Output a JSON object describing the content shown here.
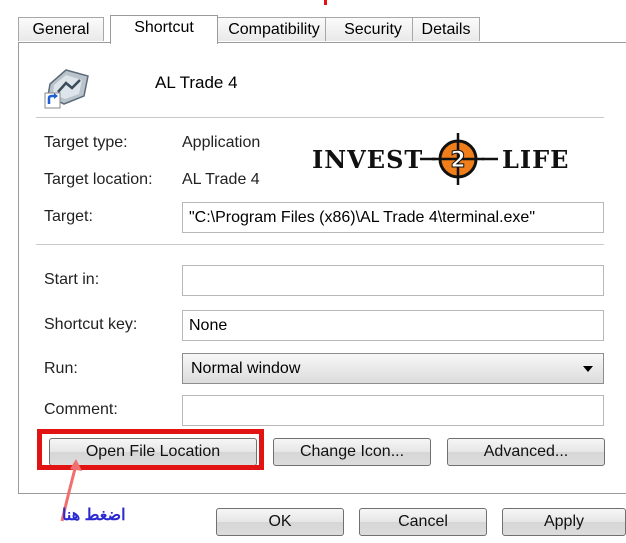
{
  "tabs": [
    {
      "label": "General"
    },
    {
      "label": "Shortcut"
    },
    {
      "label": "Compatibility"
    },
    {
      "label": "Security"
    },
    {
      "label": "Details"
    }
  ],
  "app": {
    "name": "AL Trade 4",
    "icon": "trading-app-icon"
  },
  "fields": {
    "target_type_label": "Target type:",
    "target_type_value": "Application",
    "target_location_label": "Target location:",
    "target_location_value": "AL Trade 4",
    "target_label": "Target:",
    "target_value": "\"C:\\Program Files (x86)\\AL Trade 4\\terminal.exe\"",
    "start_in_label": "Start in:",
    "start_in_value": "",
    "shortcut_key_label": "Shortcut key:",
    "shortcut_key_value": "None",
    "run_label": "Run:",
    "run_value": "Normal window",
    "comment_label": "Comment:",
    "comment_value": ""
  },
  "buttons": {
    "open_file_location": "Open File Location",
    "change_icon": "Change Icon...",
    "advanced": "Advanced...",
    "ok": "OK",
    "cancel": "Cancel",
    "apply": "Apply"
  },
  "watermark": {
    "text_left": "INVEST",
    "text_mid": "2",
    "text_right": "LIFE"
  },
  "annotation": {
    "hint": "اضغط هنا",
    "highlight_color": "#e11313",
    "hint_color": "#2a2ad0"
  }
}
